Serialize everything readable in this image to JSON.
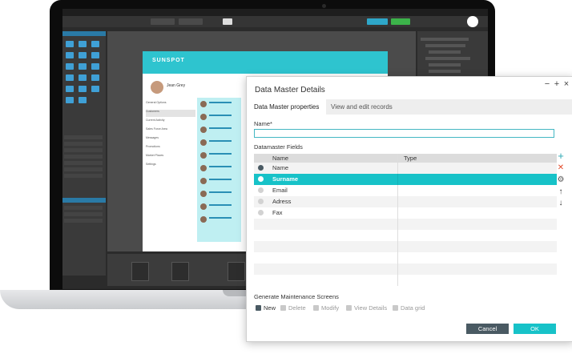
{
  "colors": {
    "accent": "#17c2c8",
    "cancel": "#4a5a63",
    "add": "#2aa7b3",
    "delete": "#e24a2a"
  },
  "background_app": {
    "logo": "SUNSPOT",
    "profile_name": "Jean Grey",
    "nav_items": [
      "General Options",
      "Customers",
      "Current Activity",
      "Sales Force Area",
      "Messages",
      "Promotions",
      "Market Places",
      "Settings"
    ]
  },
  "dialog": {
    "title": "Data Master Details",
    "window_controls": {
      "minimize": "−",
      "maximize": "+",
      "close": "×"
    },
    "tabs": [
      {
        "label": "Data Master properties",
        "active": true
      },
      {
        "label": "View and edit records",
        "active": false
      }
    ],
    "name_label": "Name*",
    "name_value": "",
    "fields_label": "Datamaster Fields",
    "columns": [
      "Name",
      "Type"
    ],
    "rows": [
      {
        "name": "Name",
        "type": "",
        "radio": "on",
        "selected": false
      },
      {
        "name": "Surname",
        "type": "",
        "radio": "white",
        "selected": true
      },
      {
        "name": "Email",
        "type": "",
        "radio": "off",
        "selected": false
      },
      {
        "name": "Adress",
        "type": "",
        "radio": "off",
        "selected": false
      },
      {
        "name": "Fax",
        "type": "",
        "radio": "off",
        "selected": false
      }
    ],
    "side_icons": [
      "plus-icon",
      "close-icon",
      "gear-icon",
      "arrow-up-icon",
      "arrow-down-icon"
    ],
    "generate_label": "Generate Maintenance Screens",
    "options": [
      {
        "label": "New",
        "checked": true
      },
      {
        "label": "Delete",
        "checked": false
      },
      {
        "label": "Modify",
        "checked": false
      },
      {
        "label": "View Details",
        "checked": false
      },
      {
        "label": "Data grid",
        "checked": false
      }
    ],
    "cancel_label": "Cancel",
    "ok_label": "OK"
  }
}
